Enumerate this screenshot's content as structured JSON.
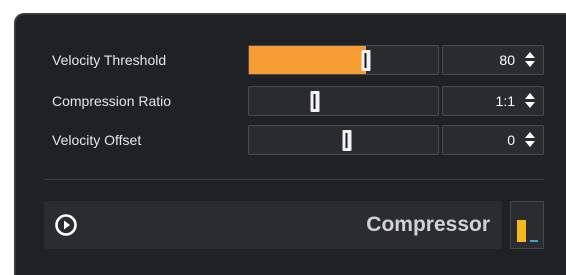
{
  "params": [
    {
      "label": "Velocity Threshold",
      "value": "80",
      "level": 0.62,
      "fill": true
    },
    {
      "label": "Compression Ratio",
      "value": "1:1",
      "level": 0.35,
      "fill": false
    },
    {
      "label": "Velocity Offset",
      "value": "0",
      "level": 0.52,
      "fill": false
    }
  ],
  "plugin": {
    "name": "Compressor",
    "enabled": true,
    "meter_level": 0.55
  },
  "icons": {
    "power": "power-icon",
    "stepper": "up-down-arrows-icon"
  },
  "colors": {
    "accent": "#f79c32",
    "panel": "#202124",
    "meter": "#f5b91f",
    "meter_secondary": "#3aa6c4"
  }
}
